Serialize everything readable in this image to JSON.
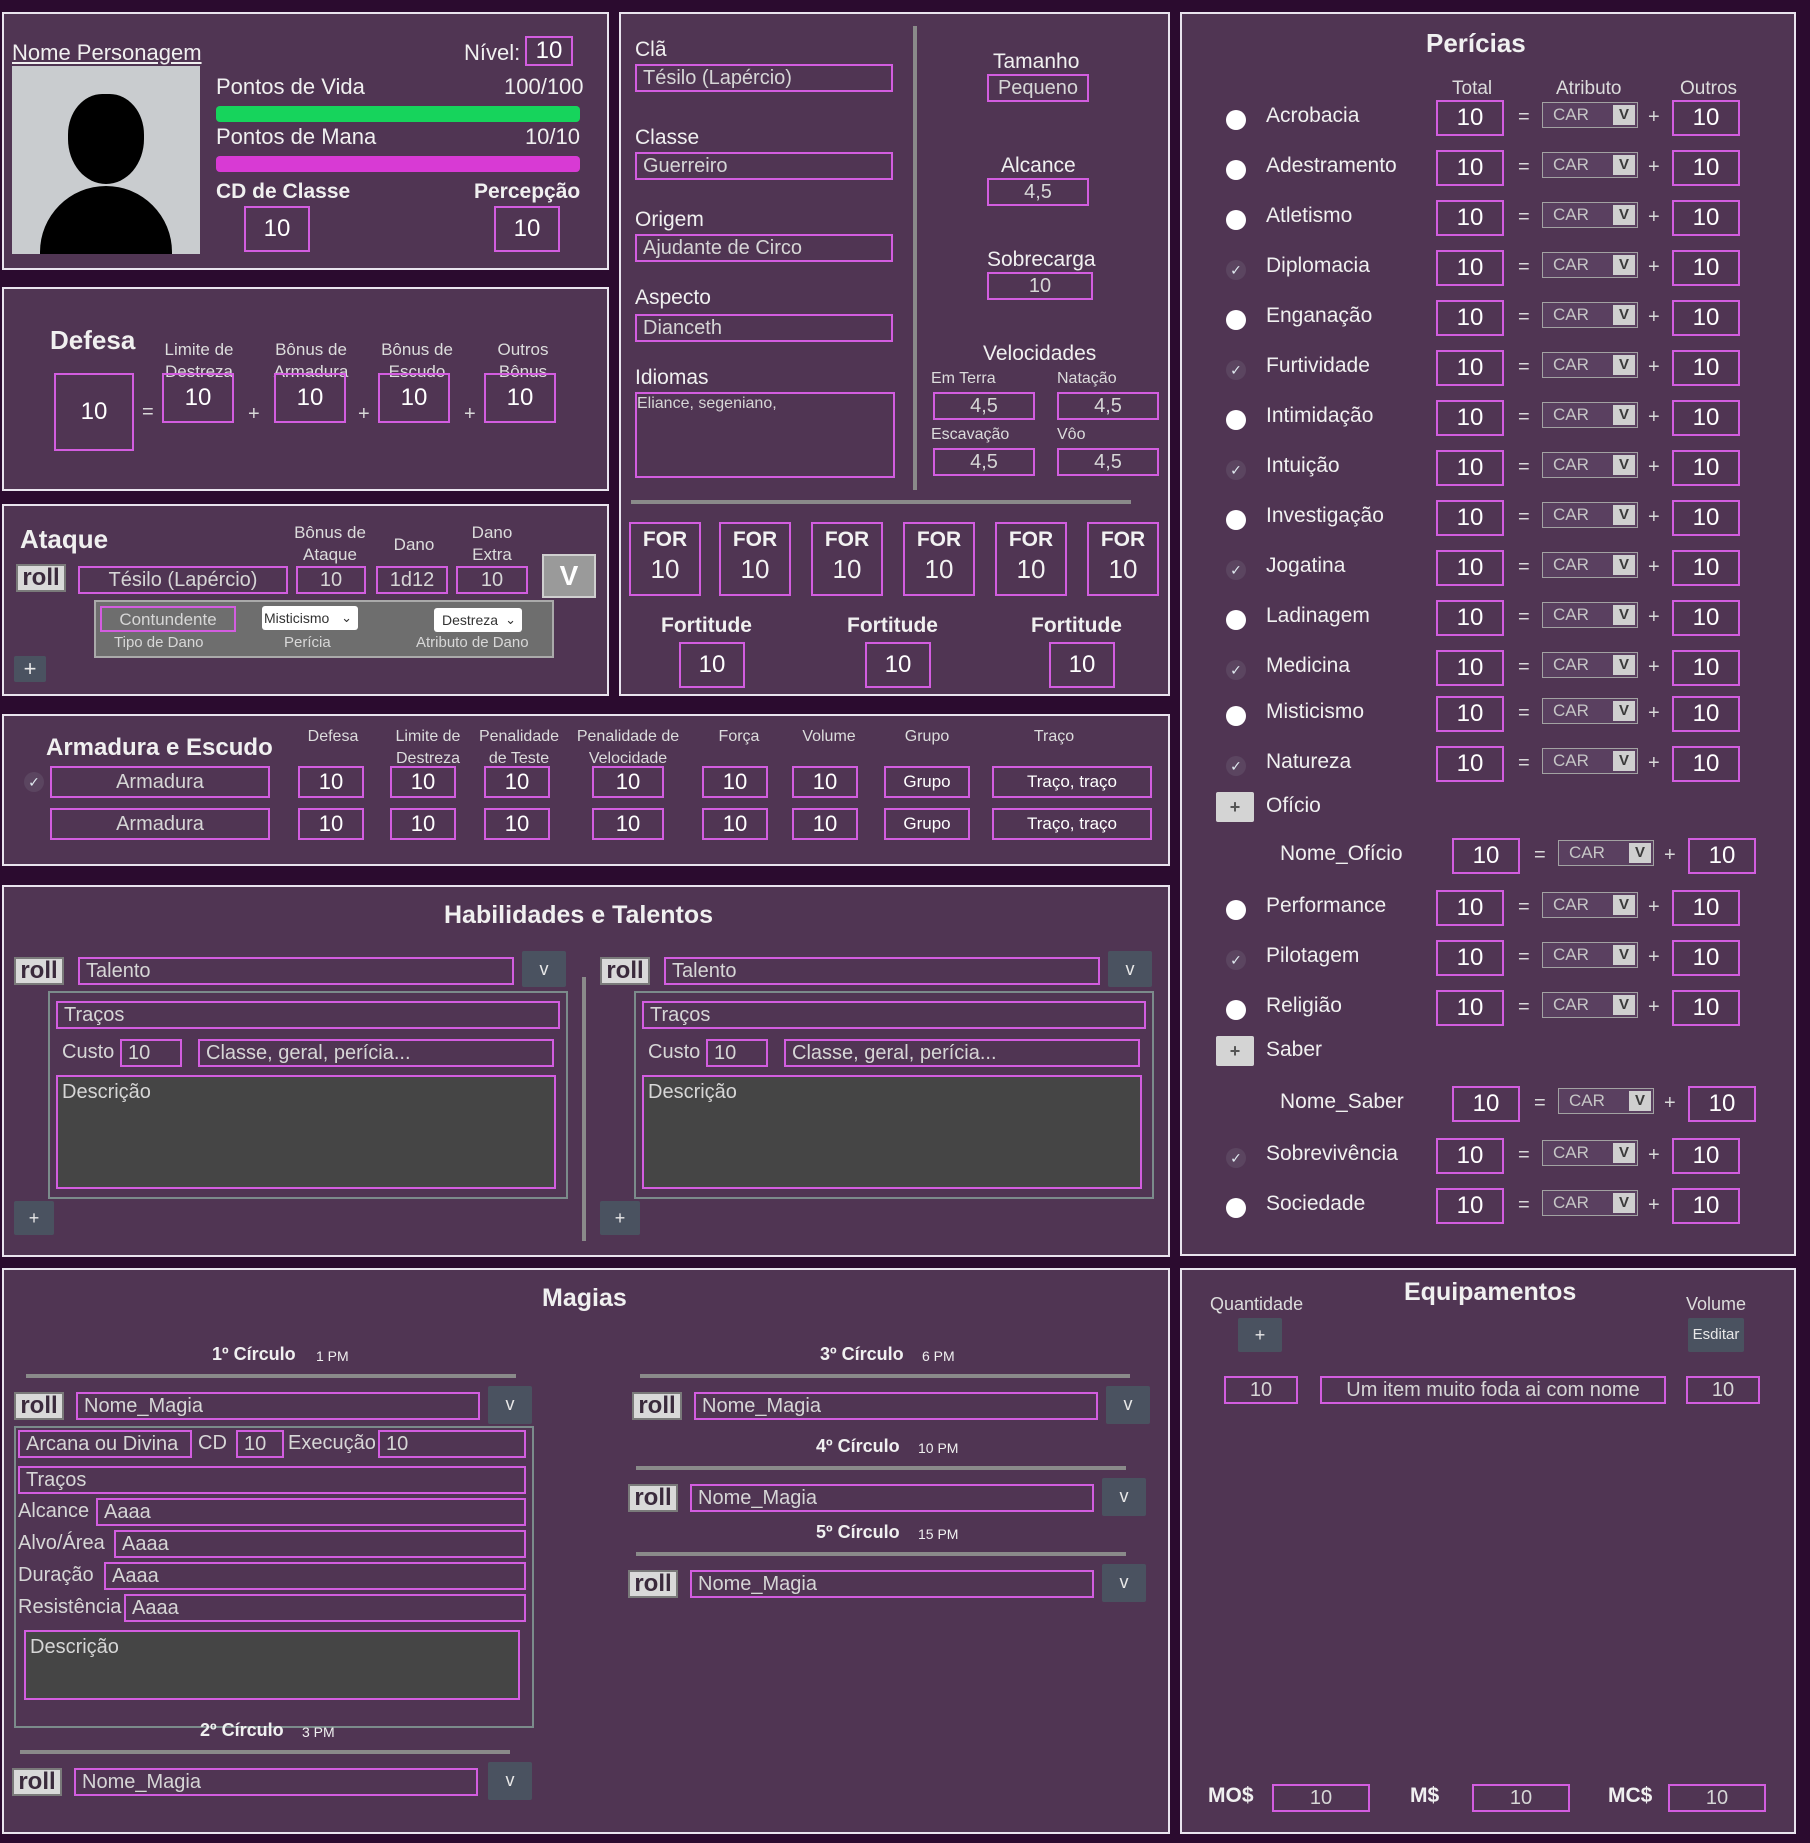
{
  "character": {
    "name_label": "Nome Personagem",
    "level_label": "Nível:",
    "level": "10",
    "hp_label": "Pontos de Vida",
    "hp_value": "100/100",
    "hp_fraction": 1.0,
    "mana_label": "Pontos de Mana",
    "mana_value": "10/10",
    "mana_fraction": 1.0,
    "class_dc_label": "CD de Classe",
    "class_dc": "10",
    "perception_label": "Percepção",
    "perception": "10"
  },
  "defense": {
    "title": "Defesa",
    "total": "10",
    "cols": [
      {
        "label": "Limite de Destreza",
        "value": "10"
      },
      {
        "label": "Bônus de Armadura",
        "value": "10"
      },
      {
        "label": "Bônus de Escudo",
        "value": "10"
      },
      {
        "label": "Outros Bônus",
        "value": "10"
      }
    ],
    "eq": "=",
    "plus": "+"
  },
  "attack": {
    "title": "Ataque",
    "roll": "roll",
    "weapon": "Tésilo (Lapércio)",
    "bonus_label": "Bônus de Ataque",
    "bonus": "10",
    "damage_label": "Dano",
    "damage": "1d12",
    "extra_label": "Dano Extra",
    "extra": "10",
    "toggle": "V",
    "damage_type": "Contundente",
    "damage_type_label": "Tipo de Dano",
    "skill": "Misticismo",
    "skill_label": "Perícia",
    "attr": "Destreza",
    "attr_label": "Atributo de Dano",
    "add": "+"
  },
  "identity": {
    "clan_label": "Clã",
    "clan": "Tésilo (Lapércio)",
    "class_label": "Classe",
    "class": "Guerreiro",
    "origin_label": "Origem",
    "origin": "Ajudante de Circo",
    "aspect_label": "Aspecto",
    "aspect": "Dianceth",
    "languages_label": "Idiomas",
    "languages": "Eliance, segeniano,",
    "size_label": "Tamanho",
    "size": "Pequeno",
    "reach_label": "Alcance",
    "reach": "4,5",
    "overload_label": "Sobrecarga",
    "overload": "10",
    "speeds_label": "Velocidades",
    "speeds": [
      {
        "label": "Em Terra",
        "value": "4,5"
      },
      {
        "label": "Natação",
        "value": "4,5"
      },
      {
        "label": "Escavação",
        "value": "4,5"
      },
      {
        "label": "Vôo",
        "value": "4,5"
      }
    ]
  },
  "attributes": [
    {
      "label": "FOR",
      "value": "10"
    },
    {
      "label": "FOR",
      "value": "10"
    },
    {
      "label": "FOR",
      "value": "10"
    },
    {
      "label": "FOR",
      "value": "10"
    },
    {
      "label": "FOR",
      "value": "10"
    },
    {
      "label": "FOR",
      "value": "10"
    }
  ],
  "saves": [
    {
      "label": "Fortitude",
      "value": "10"
    },
    {
      "label": "Fortitude",
      "value": "10"
    },
    {
      "label": "Fortitude",
      "value": "10"
    }
  ],
  "armor": {
    "title": "Armadura e  Escudo",
    "headers": [
      "Defesa",
      "Limite de Destreza",
      "Penalidade de Teste",
      "Penalidade de Velocidade",
      "Força",
      "Volume",
      "Grupo",
      "Traço"
    ],
    "rows": [
      {
        "name": "Armadura",
        "defense": "10",
        "dex": "10",
        "test": "10",
        "speed": "10",
        "str": "10",
        "vol": "10",
        "group": "Grupo",
        "trait": "Traço, traço",
        "checked": true
      },
      {
        "name": "Armadura",
        "defense": "10",
        "dex": "10",
        "test": "10",
        "speed": "10",
        "str": "10",
        "vol": "10",
        "group": "Grupo",
        "trait": "Traço, traço",
        "checked": false
      }
    ]
  },
  "talents": {
    "title": "Habilidades e Talentos",
    "cards": [
      {
        "roll": "roll",
        "name": "Talento",
        "dropdown": "v",
        "traits": "Traços",
        "cost_label": "Custo",
        "cost": "10",
        "tags": "Classe, geral, perícia...",
        "desc": "Descrição",
        "add": "+"
      },
      {
        "roll": "roll",
        "name": "Talento",
        "dropdown": "v",
        "traits": "Traços",
        "cost_label": "Custo",
        "cost": "10",
        "tags": "Classe, geral, perícia...",
        "desc": "Descrição",
        "add": "+"
      }
    ]
  },
  "skills": {
    "title": "Perícias",
    "col_total": "Total",
    "col_attr": "Atributo",
    "col_other": "Outros",
    "eq": "=",
    "plus": "+",
    "attr_default": "CAR",
    "attr_btn": "V",
    "add": "+",
    "list": [
      {
        "name": "Acrobacia",
        "total": "10",
        "other": "10",
        "mark": "radio"
      },
      {
        "name": "Adestramento",
        "total": "10",
        "other": "10",
        "mark": "radio"
      },
      {
        "name": "Atletismo",
        "total": "10",
        "other": "10",
        "mark": "radio"
      },
      {
        "name": "Diplomacia",
        "total": "10",
        "other": "10",
        "mark": "check"
      },
      {
        "name": "Enganação",
        "total": "10",
        "other": "10",
        "mark": "radio"
      },
      {
        "name": "Furtividade",
        "total": "10",
        "other": "10",
        "mark": "check"
      },
      {
        "name": "Intimidação",
        "total": "10",
        "other": "10",
        "mark": "radio"
      },
      {
        "name": "Intuição",
        "total": "10",
        "other": "10",
        "mark": "check"
      },
      {
        "name": "Investigação",
        "total": "10",
        "other": "10",
        "mark": "radio"
      },
      {
        "name": "Jogatina",
        "total": "10",
        "other": "10",
        "mark": "check"
      },
      {
        "name": "Ladinagem",
        "total": "10",
        "other": "10",
        "mark": "radio"
      },
      {
        "name": "Medicina",
        "total": "10",
        "other": "10",
        "mark": "check"
      },
      {
        "name": "Misticismo",
        "total": "10",
        "other": "10",
        "mark": "radio"
      },
      {
        "name": "Natureza",
        "total": "10",
        "other": "10",
        "mark": "check"
      },
      {
        "name": "Ofício",
        "group": true
      },
      {
        "name": "Nome_Ofício",
        "total": "10",
        "other": "10",
        "mark": "sub"
      },
      {
        "name": "Performance",
        "total": "10",
        "other": "10",
        "mark": "radio"
      },
      {
        "name": "Pilotagem",
        "total": "10",
        "other": "10",
        "mark": "check"
      },
      {
        "name": "Religião",
        "total": "10",
        "other": "10",
        "mark": "radio"
      },
      {
        "name": "Saber",
        "group": true
      },
      {
        "name": "Nome_Saber",
        "total": "10",
        "other": "10",
        "mark": "sub"
      },
      {
        "name": "Sobrevivência",
        "total": "10",
        "other": "10",
        "mark": "check"
      },
      {
        "name": "Sociedade",
        "total": "10",
        "other": "10",
        "mark": "radio"
      }
    ]
  },
  "spells": {
    "title": "Magias",
    "roll": "roll",
    "dropdown": "v",
    "circles": [
      {
        "label": "1º Círculo",
        "pm": "1 PM",
        "name": "Nome_Magia"
      },
      {
        "label": "2º Círculo",
        "pm": "3 PM",
        "name": "Nome_Magia"
      },
      {
        "label": "3º Círculo",
        "pm": "6 PM",
        "name": "Nome_Magia"
      },
      {
        "label": "4º Círculo",
        "pm": "10 PM",
        "name": "Nome_Magia"
      },
      {
        "label": "5º Círculo",
        "pm": "15 PM",
        "name": "Nome_Magia"
      }
    ],
    "detail": {
      "tradition": "Arcana ou Divina",
      "cd_label": "CD",
      "cd": "10",
      "exec_label": "Execução",
      "exec": "10",
      "traits": "Traços",
      "reach_label": "Alcance",
      "reach": "Aaaa",
      "target_label": "Alvo/Área",
      "target": "Aaaa",
      "duration_label": "Duração",
      "duration": "Aaaa",
      "resist_label": "Resistência",
      "resist": "Aaaa",
      "desc": "Descrição"
    }
  },
  "equipment": {
    "title": "Equipamentos",
    "qty_label": "Quantidade",
    "vol_label": "Volume",
    "add": "+",
    "edit": "Esditar",
    "items": [
      {
        "qty": "10",
        "name": "Um item muito foda ai com nome",
        "vol": "10"
      }
    ],
    "coins": [
      {
        "label": "MO$",
        "value": "10"
      },
      {
        "label": "M$",
        "value": "10"
      },
      {
        "label": "MC$",
        "value": "10"
      }
    ]
  },
  "colors": {
    "background": "#2b0b2f",
    "panel": "#503553",
    "field_border": "#d35de0",
    "hp_bar": "#16d45c",
    "mana_bar": "#d83ad4"
  }
}
